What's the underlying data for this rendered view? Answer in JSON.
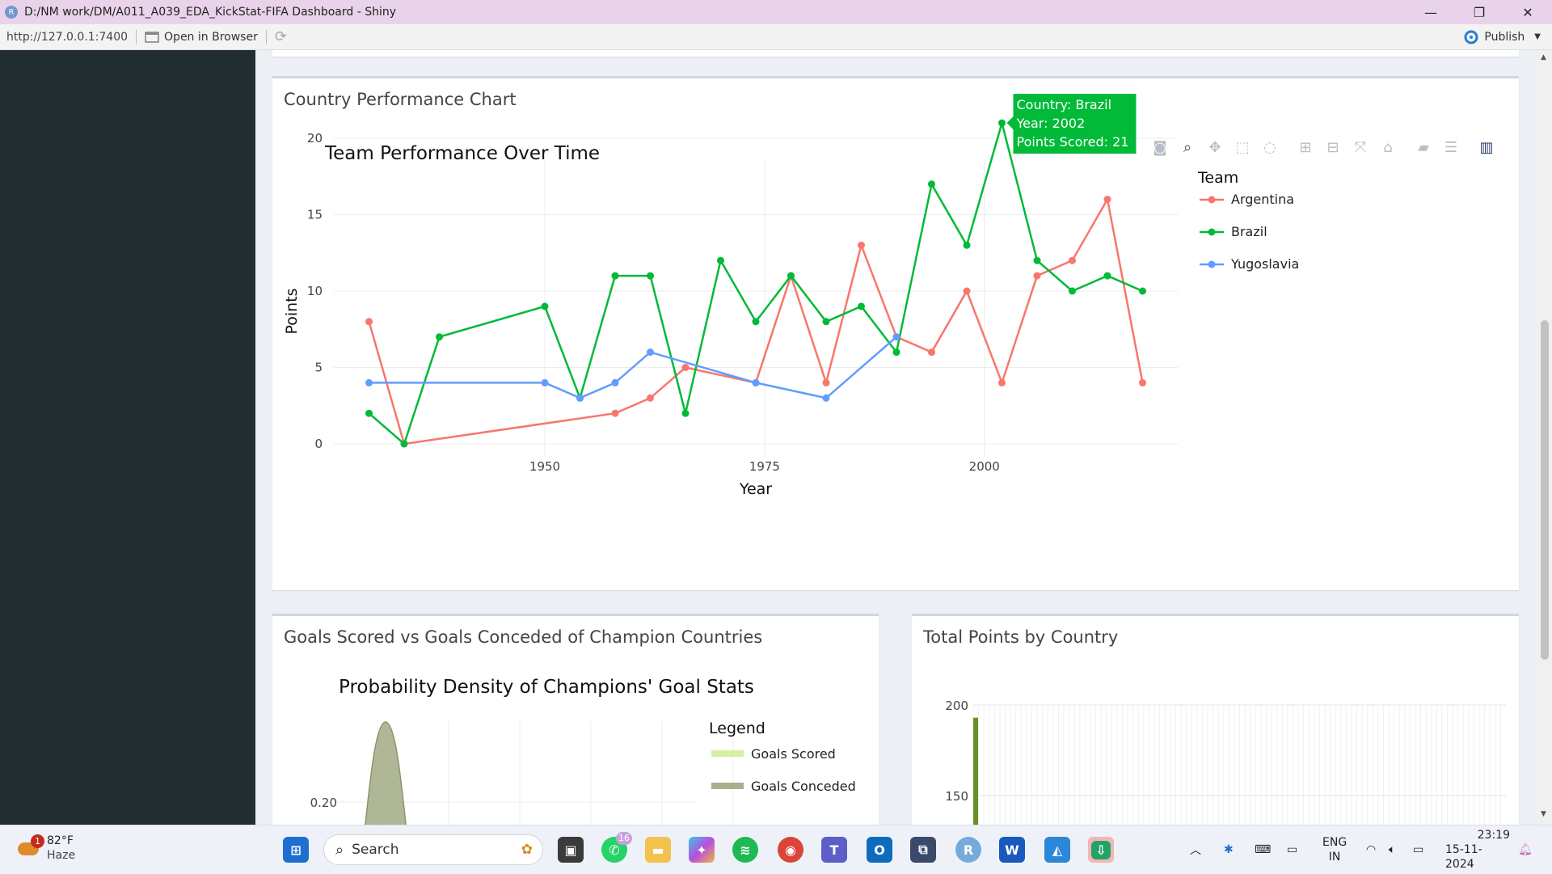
{
  "window": {
    "title": "D:/NM work/DM/A011_A039_EDA_KickStat-FIFA Dashboard - Shiny",
    "minimize": "—",
    "restore": "❐",
    "close": "✕"
  },
  "addressbar": {
    "url": "http://127.0.0.1:7400",
    "open_in_browser": "Open in Browser",
    "publish": "Publish"
  },
  "country_box": {
    "title": "Country Performance Chart"
  },
  "chart_data": [
    {
      "type": "line",
      "title": "Team Performance Over Time",
      "xlabel": "Year",
      "ylabel": "Points",
      "xlim": [
        1926,
        2022
      ],
      "ylim": [
        -0.5,
        22
      ],
      "xticks": [
        1950,
        1975,
        2000
      ],
      "yticks": [
        0,
        5,
        10,
        15,
        20
      ],
      "grid": true,
      "legend_title": "Team",
      "legend_position": "right",
      "series": [
        {
          "name": "Argentina",
          "color": "#f8766d",
          "x": [
            1930,
            1934,
            1958,
            1962,
            1966,
            1974,
            1978,
            1982,
            1986,
            1990,
            1994,
            1998,
            2002,
            2006,
            2010,
            2014,
            2018
          ],
          "y": [
            8,
            0,
            2,
            3,
            5,
            4,
            11,
            4,
            13,
            7,
            6,
            10,
            4,
            11,
            12,
            16,
            4
          ]
        },
        {
          "name": "Brazil",
          "color": "#00ba38",
          "x": [
            1930,
            1934,
            1938,
            1950,
            1954,
            1958,
            1962,
            1966,
            1970,
            1974,
            1978,
            1982,
            1986,
            1990,
            1994,
            1998,
            2002,
            2006,
            2010,
            2014,
            2018
          ],
          "y": [
            2,
            0,
            7,
            9,
            3,
            11,
            11,
            2,
            12,
            8,
            11,
            8,
            9,
            6,
            17,
            13,
            21,
            12,
            10,
            11,
            10
          ]
        },
        {
          "name": "Yugoslavia",
          "color": "#619cff",
          "x": [
            1930,
            1950,
            1954,
            1958,
            1962,
            1974,
            1982,
            1990
          ],
          "y": [
            4,
            4,
            3,
            4,
            6,
            4,
            3,
            7
          ]
        }
      ],
      "tooltip": {
        "line1": "Country:  Brazil",
        "line2": "Year:  2002",
        "line3": "Points Scored:  21",
        "color": "#00ba38"
      }
    },
    {
      "type": "area",
      "title": "Probability Density of Champions' Goal Stats",
      "ytick_labels": [
        "0.20"
      ],
      "ylim": [
        0,
        0.27
      ],
      "legend_title": "Legend",
      "legend_position": "right",
      "series": [
        {
          "name": "Goals Scored",
          "color": "#d4f0a0"
        },
        {
          "name": "Goals Conceded",
          "color": "#a8b08c",
          "peak": 0.29
        }
      ]
    },
    {
      "type": "bar",
      "ytick_labels": [
        "200",
        "150"
      ],
      "values": [
        193
      ],
      "ylim": [
        130,
        210
      ],
      "grid": true,
      "bar_color": "#6b8e23"
    }
  ],
  "goals_box": {
    "title": "Goals Scored vs Goals Conceded of Champion Countries"
  },
  "points_box": {
    "title": "Total Points by Country"
  },
  "modebar": [
    "camera-icon",
    "zoom-icon",
    "pan-icon",
    "box-select-icon",
    "lasso-icon",
    "zoom-in-icon",
    "zoom-out-icon",
    "autoscale-icon",
    "reset-axes-icon",
    "hover-closest-icon",
    "hover-compare-icon",
    "plotly-logo-icon"
  ],
  "taskbar": {
    "weather_temp": "82°F",
    "weather_desc": "Haze",
    "weather_badge": "1",
    "search_placeholder": "Search",
    "whatsapp_badge": "16",
    "lang1": "ENG",
    "lang2": "IN",
    "time": "23:19",
    "date": "15-11-2024"
  }
}
